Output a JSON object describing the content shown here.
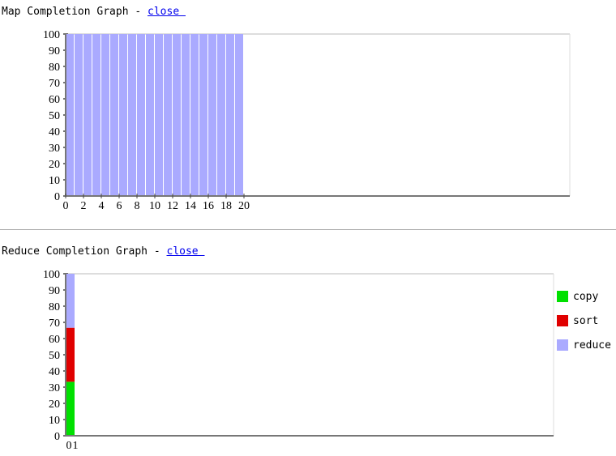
{
  "map": {
    "title": "Map Completion Graph - ",
    "close": "close "
  },
  "reduce": {
    "title": "Reduce Completion Graph - ",
    "close": "close "
  },
  "colors": {
    "map": "#aaaaff",
    "copy": "#00e000",
    "sort": "#e00000",
    "reduce": "#aaaaff"
  },
  "chart_data": [
    {
      "type": "bar",
      "ylim": [
        0,
        100
      ],
      "xlim": [
        0,
        20
      ],
      "yticks": [
        "0",
        "10",
        "20",
        "30",
        "40",
        "50",
        "60",
        "70",
        "80",
        "90",
        "100"
      ],
      "xticks": [
        "0",
        "2",
        "4",
        "6",
        "8",
        "10",
        "12",
        "14",
        "16",
        "18",
        "20"
      ],
      "values": [
        100,
        100,
        100,
        100,
        100,
        100,
        100,
        100,
        100,
        100,
        100,
        100,
        100,
        100,
        100,
        100,
        100,
        100,
        100,
        100
      ]
    },
    {
      "type": "bar",
      "stacked": true,
      "ylim": [
        0,
        100
      ],
      "yticks": [
        "0",
        "10",
        "20",
        "30",
        "40",
        "50",
        "60",
        "70",
        "80",
        "90",
        "100"
      ],
      "xticks": [
        "0",
        "1"
      ],
      "legend_position": "right",
      "series": [
        {
          "name": "copy",
          "values": [
            33.3
          ]
        },
        {
          "name": "sort",
          "values": [
            33.3
          ]
        },
        {
          "name": "reduce",
          "values": [
            33.3
          ]
        }
      ]
    }
  ]
}
